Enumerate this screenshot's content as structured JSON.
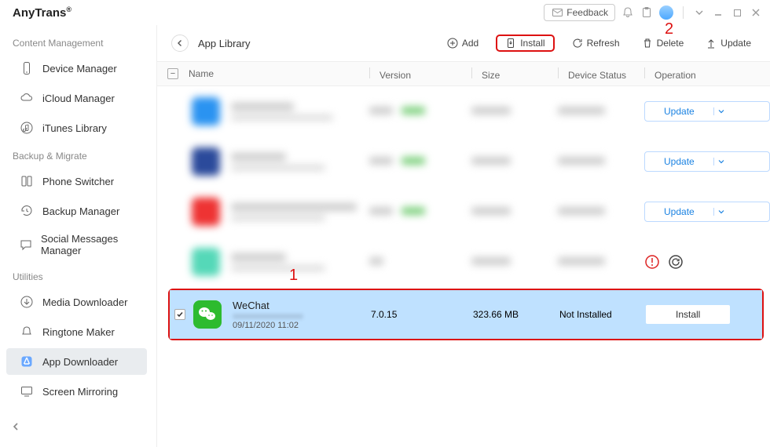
{
  "app": {
    "title": "AnyTrans",
    "reg": "®"
  },
  "titlebar": {
    "feedback": "Feedback"
  },
  "sidebar": {
    "groups": [
      {
        "label": "Content Management",
        "items": [
          "Device Manager",
          "iCloud Manager",
          "iTunes Library"
        ]
      },
      {
        "label": "Backup & Migrate",
        "items": [
          "Phone Switcher",
          "Backup Manager",
          "Social Messages Manager"
        ]
      },
      {
        "label": "Utilities",
        "items": [
          "Media Downloader",
          "Ringtone Maker",
          "App Downloader",
          "Screen Mirroring"
        ]
      }
    ],
    "active": "App Downloader"
  },
  "toolbar": {
    "title": "App Library",
    "actions": {
      "add": "Add",
      "install": "Install",
      "refresh": "Refresh",
      "delete": "Delete",
      "update": "Update"
    }
  },
  "table": {
    "headers": {
      "name": "Name",
      "version": "Version",
      "size": "Size",
      "status": "Device Status",
      "op": "Operation"
    },
    "update_label": "Update"
  },
  "selected": {
    "name": "WeChat",
    "date": "09/11/2020 11:02",
    "version": "7.0.15",
    "size": "323.66 MB",
    "status": "Not Installed",
    "install_label": "Install"
  },
  "annotations": {
    "one": "1",
    "two": "2"
  }
}
